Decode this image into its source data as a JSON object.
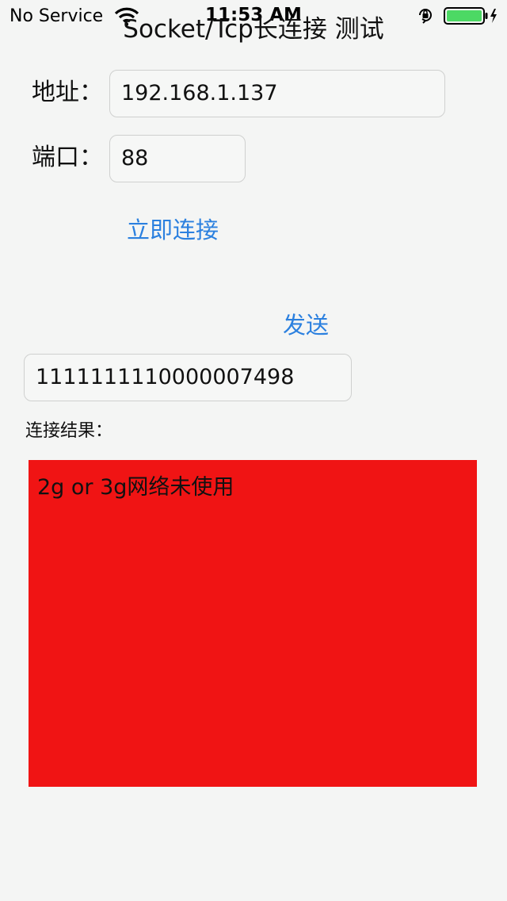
{
  "status_bar": {
    "carrier": "No Service",
    "time": "11:53 AM",
    "wifi_icon": "wifi-icon",
    "lock_icon": "orientation-lock-icon",
    "battery_icon": "battery-charging-icon",
    "battery_color": "#4cd964"
  },
  "nav": {
    "title": "Socket/Tcp长连接 测试"
  },
  "form": {
    "address_label": "地址：",
    "address_value": "192.168.1.137",
    "port_label": "端口：",
    "port_value": "88",
    "connect_label": "立即连接",
    "send_label": "发送",
    "message_value": "1111111110000007498"
  },
  "result": {
    "label": "连接结果：",
    "text": "2g or 3g网络未使用",
    "background": "#f01414"
  },
  "colors": {
    "accent": "#2b80df",
    "background": "#f4f5f4"
  }
}
